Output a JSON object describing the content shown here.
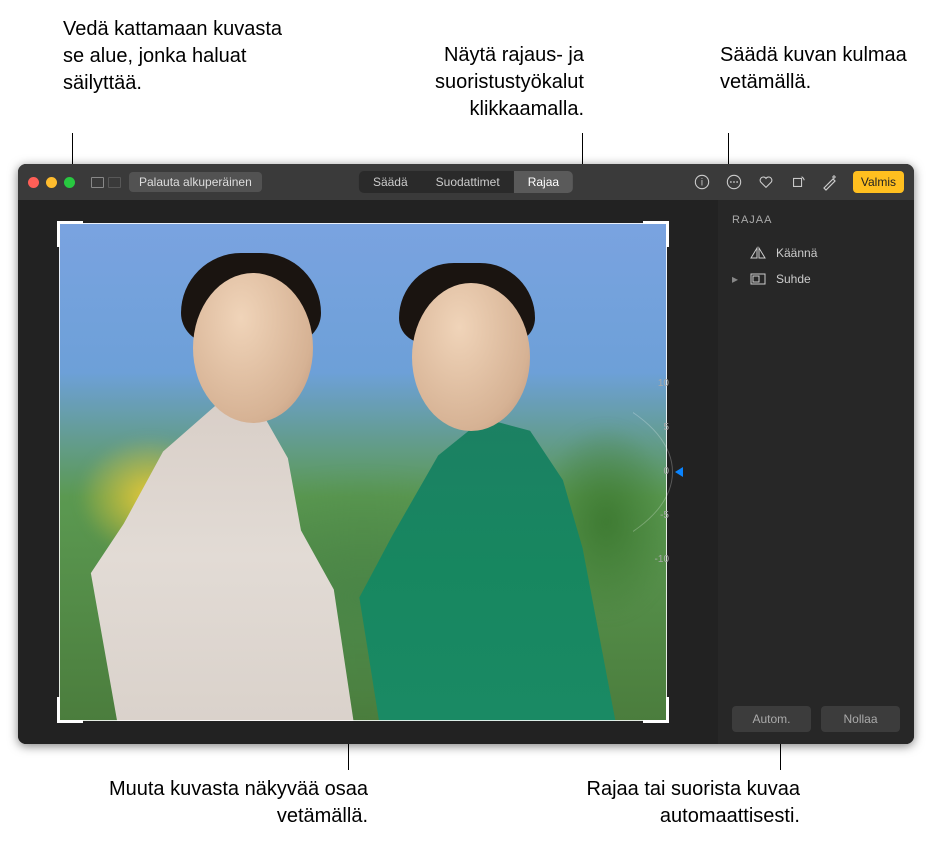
{
  "callouts": {
    "drag_keep": "Vedä kattamaan kuvasta se alue, jonka haluat säilyttää.",
    "show_crop": "Näytä rajaus- ja suoristustyökalut klikkaamalla.",
    "adjust_angle": "Säädä kuvan kulmaa vetämällä.",
    "change_visible": "Muuta kuvasta näkyvää osaa vetämällä.",
    "auto_crop": "Rajaa tai suorista kuvaa automaattisesti."
  },
  "toolbar": {
    "revert": "Palauta alkuperäinen",
    "tabs": {
      "adjust": "Säädä",
      "filters": "Suodattimet",
      "crop": "Rajaa"
    },
    "done": "Valmis"
  },
  "sidebar": {
    "title": "RAJAA",
    "flip": "Käännä",
    "aspect": "Suhde",
    "auto": "Autom.",
    "reset": "Nollaa"
  },
  "dial": {
    "plus10": "10",
    "plus5": "5",
    "zero": "0",
    "minus5": "-5",
    "minus10": "-10"
  }
}
